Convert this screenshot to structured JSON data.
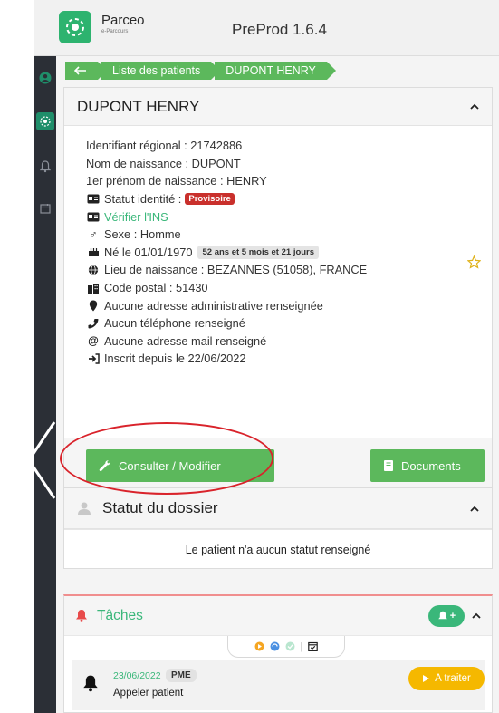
{
  "app": {
    "brand_name": "Parceo",
    "brand_subtitle": "e-Parcours",
    "title": "PreProd 1.6.4"
  },
  "breadcrumb": {
    "back_icon": "arrow-left-icon",
    "items": [
      "Liste des patients",
      "DUPONT HENRY"
    ]
  },
  "patient": {
    "name": "DUPONT HENRY",
    "fields": {
      "identifiant": "Identifiant régional : 21742886",
      "nom_naissance": "Nom de naissance : DUPONT",
      "prenom_naissance": "1er prénom de naissance : HENRY",
      "statut_identite": "Statut identité :",
      "statut_badge": "Provisoire",
      "verifier_ins": "Vérifier l'INS",
      "sexe": "Sexe : Homme",
      "naissance": "Né le 01/01/1970",
      "age_badge": "52 ans et 5 mois et 21 jours",
      "lieu": "Lieu de naissance : BEZANNES (51058), FRANCE",
      "code_postal": "Code postal : 51430",
      "adresse": "Aucune adresse administrative renseignée",
      "telephone": "Aucun téléphone renseigné",
      "mail": "Aucune adresse mail renseigné",
      "inscrit": "Inscrit depuis le 22/06/2022"
    },
    "buttons": {
      "consulter": "Consulter / Modifier",
      "documents": "Documents"
    }
  },
  "statut_dossier": {
    "title": "Statut du dossier",
    "message": "Le patient n'a aucun statut renseigné"
  },
  "taches": {
    "title": "Tâches",
    "add_label": "+",
    "task": {
      "date": "23/06/2022",
      "badge": "PME",
      "label": "Appeler patient",
      "action": "A traiter"
    }
  },
  "colors": {
    "accent_green": "#5cb85c",
    "sidebar_dark": "#2b2f36",
    "provisoire_red": "#c9302c",
    "a_traiter_yellow": "#f5b800",
    "annotation_red": "#d9232b"
  }
}
